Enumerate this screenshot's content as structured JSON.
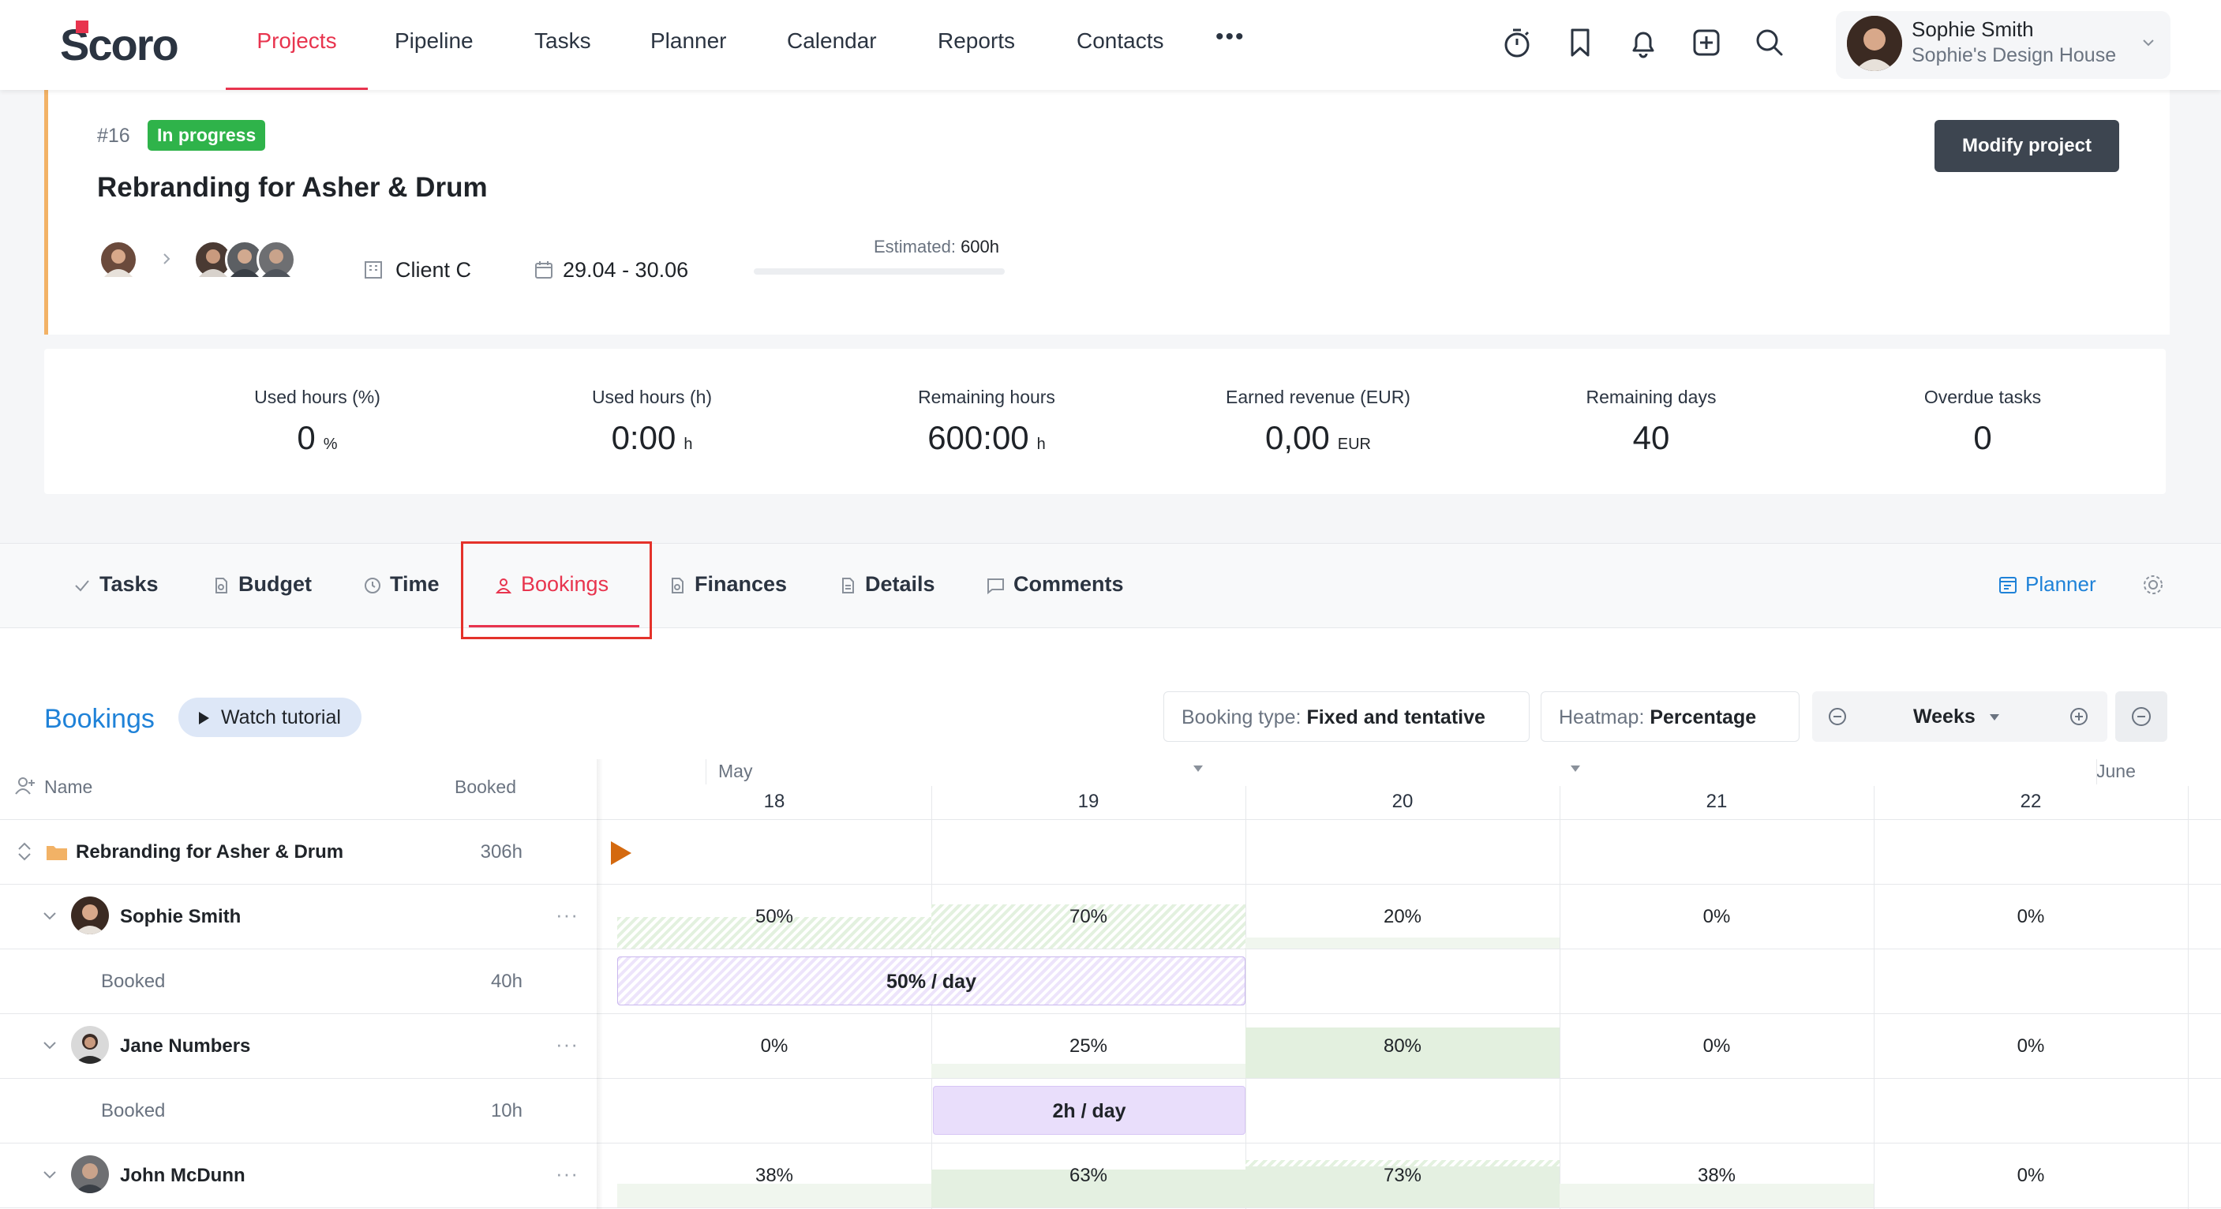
{
  "nav": {
    "logo": "Scoro",
    "items": [
      "Projects",
      "Pipeline",
      "Tasks",
      "Planner",
      "Calendar",
      "Reports",
      "Contacts"
    ],
    "more": "•••",
    "active": "Projects"
  },
  "user": {
    "name": "Sophie Smith",
    "company": "Sophie's Design House"
  },
  "project": {
    "number": "#16",
    "status": "In progress",
    "title": "Rebranding for Asher & Drum",
    "modify_label": "Modify project",
    "client": "Client C",
    "dates": "29.04 - 30.06",
    "estimated_label": "Estimated:",
    "estimated_value": "600h",
    "estimated_progress": 0.0
  },
  "stats": [
    {
      "label": "Used hours (%)",
      "value": "0",
      "unit": "%"
    },
    {
      "label": "Used hours (h)",
      "value": "0:00",
      "unit": "h"
    },
    {
      "label": "Remaining hours",
      "value": "600:00",
      "unit": "h"
    },
    {
      "label": "Earned revenue (EUR)",
      "value": "0,00",
      "unit": "EUR"
    },
    {
      "label": "Remaining days",
      "value": "40",
      "unit": ""
    },
    {
      "label": "Overdue tasks",
      "value": "0",
      "unit": ""
    }
  ],
  "tabs": [
    "Tasks",
    "Budget",
    "Time",
    "Bookings",
    "Finances",
    "Details",
    "Comments"
  ],
  "active_tab": "Bookings",
  "planner_link": "Planner",
  "bookings": {
    "title": "Bookings",
    "tutorial_label": "Watch tutorial",
    "booking_type_label": "Booking type:",
    "booking_type_value": "Fixed and tentative",
    "heatmap_label": "Heatmap:",
    "heatmap_value": "Percentage",
    "zoom_label": "Weeks",
    "columns": {
      "name": "Name",
      "booked": "Booked"
    },
    "months": [
      "May",
      "June"
    ],
    "weeks": [
      "18",
      "19",
      "20",
      "21",
      "22"
    ],
    "project_row": {
      "name": "Rebranding for Asher & Drum",
      "booked": "306h"
    },
    "people": [
      {
        "name": "Sophie Smith",
        "pct": [
          "50%",
          "70%",
          "20%",
          "0%",
          "0%"
        ],
        "sub_label": "Booked",
        "sub_booked": "40h",
        "bar_label": "50% / day"
      },
      {
        "name": "Jane Numbers",
        "pct": [
          "0%",
          "25%",
          "80%",
          "0%",
          "0%"
        ],
        "sub_label": "Booked",
        "sub_booked": "10h",
        "bar_label": "2h / day"
      },
      {
        "name": "John McDunn",
        "pct": [
          "38%",
          "63%",
          "73%",
          "38%",
          "0%"
        ]
      }
    ]
  },
  "colors": {
    "accent": "#e8344e",
    "link": "#1f82d8",
    "status_green": "#2fb34a",
    "dark_button": "#3d4550"
  }
}
